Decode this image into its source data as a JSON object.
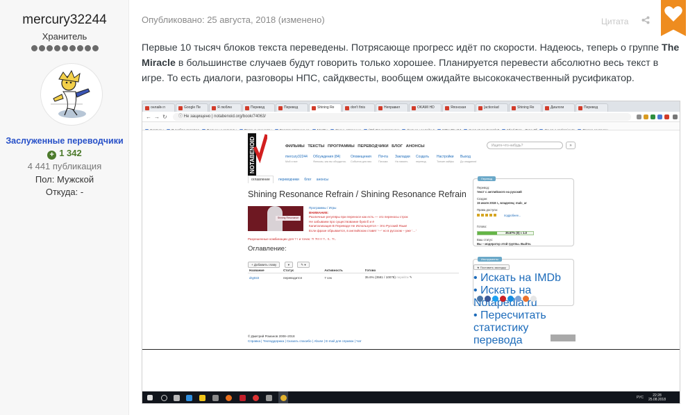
{
  "author": {
    "name": "mercury32244",
    "rank": "Хранитель",
    "group": "Заслуженные переводчики",
    "reputation": "1 342",
    "posts": "4 441 публикация",
    "gender": "Пол: Мужской",
    "location": "Откуда: -"
  },
  "post": {
    "meta": "Опубликовано: 25 августа, 2018 (изменено)",
    "quote_label": "Цитата",
    "text_before_bold": "Первые 10 тысяч блоков текста переведены. Потрясающе прогресс идёт по скорости. Надеюсь, теперь о группе ",
    "bold": "The Miracle",
    "text_after_bold": " в большинстве случаев будут говорить только хорошее. Планируется перевести абсолютно весь текст в игре. То есть диалоги, разговоры НПС, сайдквесты, вообщем ожидайте высококачественный русификатор.",
    "accent_color": "#ee8c1f"
  },
  "screenshot": {
    "tabs": [
      "онлайн п",
      "Google Пе",
      "Я люблю",
      "Перевод",
      "Перевод",
      "Shining Re",
      "don't finis",
      "Неправил",
      "OKAMI HD",
      "Японская",
      "[action/ad",
      "Shining Re",
      "Диалоги",
      "Перевод"
    ],
    "active_tab": 5,
    "url_prefix": "Не защищено",
    "url": "notabenoid.org/book/74063/",
    "bookmarks": [
      "Сервисы",
      "Я люблю перевод",
      "Фильмы и сериалы",
      "Полные концерты",
      "Восстановление за",
      "МатРы",
      "Очень странные",
      "(28) Одноклассники",
      "фильмы онлайн в",
      "WFI x86-x64",
      "Xuan-Yuan Sword III",
      "Mind Zero - Zone Of",
      "Go on a rocket journ",
      "Другие закладки"
    ],
    "site": {
      "menu": "ФИЛЬМЫ ТЕКСТЫ ПРОГРАММЫ ПЕРЕВОДЧИКИ БЛОГ АНОНСЫ",
      "search_placeholder": "Ищите-что-нибудь?",
      "search_go": "»",
      "sub_links": [
        {
          "label": "mercury32244",
          "hint": "Мой и все"
        },
        {
          "label": "Обсуждения (84)",
          "hint": "Фильмы, как вы обсудилсь"
        },
        {
          "label": "Оповещения",
          "hint": "События для вас"
        },
        {
          "label": "Почта",
          "hint": "Письма"
        },
        {
          "label": "Закладки",
          "hint": "На память"
        },
        {
          "label": "Создать",
          "hint": "перевод"
        },
        {
          "label": "Настройки",
          "hint": "Тонкие кайфы"
        },
        {
          "label": "Выход",
          "hint": "До свидания!"
        }
      ],
      "tabs": [
        "оглавление",
        "переводчики",
        "блог",
        "анонсы"
      ],
      "title": "Shining Resonance Refrain / Shining Resonance Refrain",
      "cover_text": "Shining Resonance",
      "category": "Программы / Игры",
      "warning_title": "ВНИМАНИЕ:",
      "warning_lines": [
        "Различные регуляры при переносе как есть — это переносы строк",
        "Не забываем про существование букв Ё и ё",
        "Капитализация В Переводе Не Используется – Это Русский Язык!",
        "Если фразе обрывается, в английском ставят '---' но в русском – уже '…'"
      ],
      "permission": "Разрешенные комбинации для ? ! и точек: ?! ?!!! !! ?.. !!.. ?!..",
      "toc": "Оглавление:",
      "add_chapter": "+ Добавить главу",
      "table_headers": [
        "Название",
        "Статус",
        "Активность",
        "Готово"
      ],
      "row": {
        "name": "drg022",
        "status": "переводится",
        "activity": "7 сек",
        "done": "35.6% (3581 / 10078)",
        "action": "перейти"
      },
      "box_title": "Перевод",
      "box_lines": [
        "Перевод:",
        "текст с английского на русский",
        "Создан:",
        "15 июля 2018 г., владелец: malc_ar",
        "Права доступа:",
        "подробнее...",
        "Готово:",
        "Ваш статус:",
        "Вы – модератор этой группы. Выйти."
      ],
      "progress": 0.356,
      "progress_label": "35.67% (0) ≈ 1.0",
      "tools_title": "Инструменты",
      "bookmark_btn": "Поставить закладку",
      "tools_links": [
        "Искать на IMDb",
        "Искать на Notapedia.ru",
        "Пересчитать статистику перевода"
      ],
      "footer_line1": "© Дмитрий Романов 2008–2018",
      "footer_line2": "Справка | Техподдержка | Сказать спасибо | Abuse | E-mail для справок | Чат"
    },
    "taskbar": {
      "lang": "РУС",
      "time": "22:28",
      "date": "25.08.2018"
    }
  }
}
